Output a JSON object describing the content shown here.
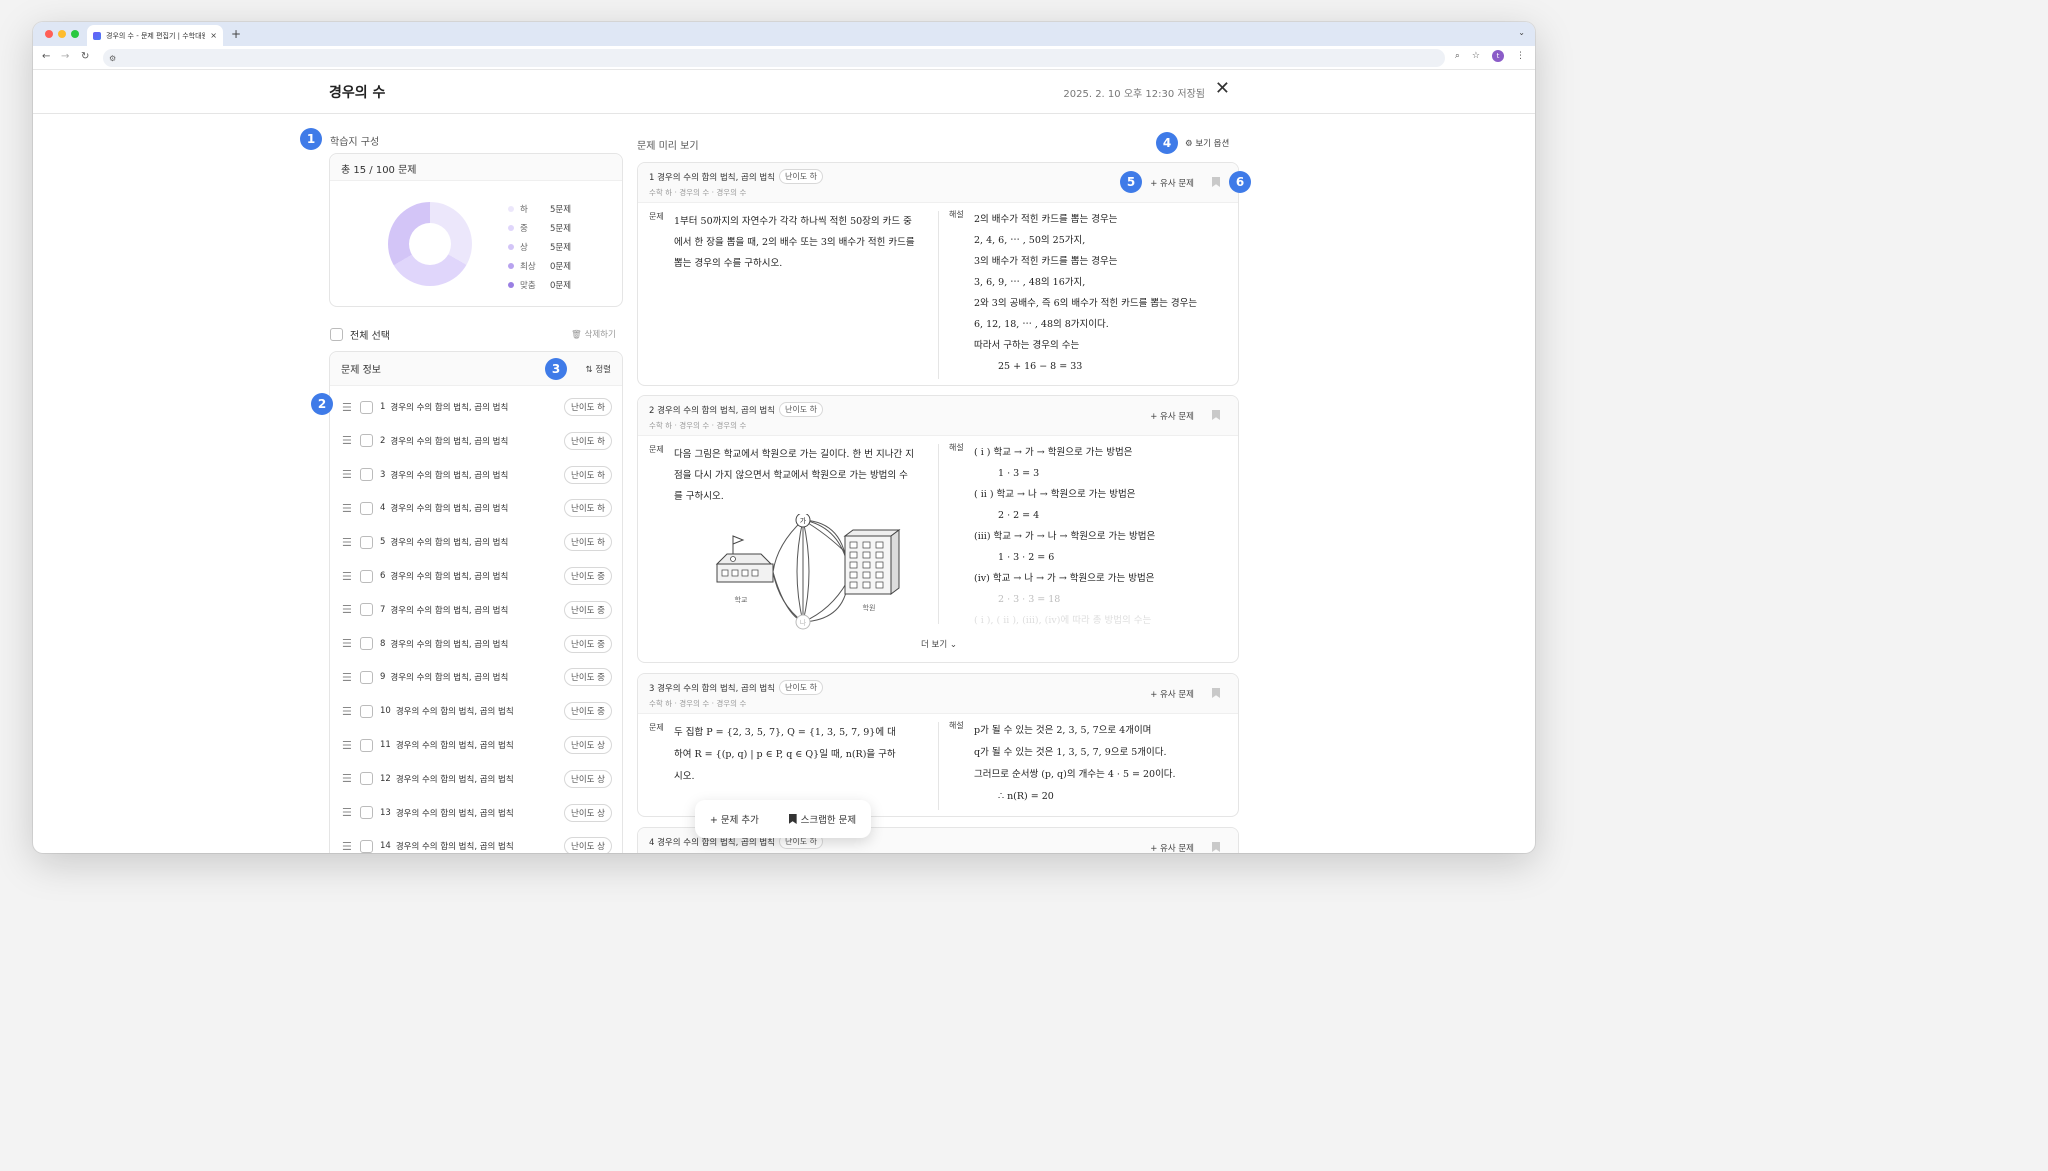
{
  "browser": {
    "tab_title": "경우의 수 - 문제 편집기 | 수학대왕",
    "new_tab": "+",
    "tab_close": "×"
  },
  "header": {
    "title": "경우의 수",
    "save_status": "2025. 2. 10 오후 12:30 저장됨",
    "close": "✕"
  },
  "markers": [
    "1",
    "2",
    "3",
    "4",
    "5",
    "6"
  ],
  "worksheet": {
    "label": "학습지 구성",
    "summary": "총 15 / 100 문제",
    "legend": [
      {
        "label": "하",
        "count": "5문제",
        "color": "#ece7fb"
      },
      {
        "label": "중",
        "count": "5문제",
        "color": "#e0d6fb"
      },
      {
        "label": "상",
        "count": "5문제",
        "color": "#d3c5f7"
      },
      {
        "label": "최상",
        "count": "0문제",
        "color": "#b8a3ef"
      },
      {
        "label": "맞춤",
        "count": "0문제",
        "color": "#9a7fe3"
      }
    ],
    "select_all": "전체 선택",
    "delete": "🗑 삭제하기",
    "list_title": "문제 정보",
    "sort": "⇅ 정렬",
    "problems": [
      {
        "num": "1",
        "title": "경우의 수의 합의 법칙, 곱의 법칙",
        "diff": "난이도 하"
      },
      {
        "num": "2",
        "title": "경우의 수의 합의 법칙, 곱의 법칙",
        "diff": "난이도 하"
      },
      {
        "num": "3",
        "title": "경우의 수의 합의 법칙, 곱의 법칙",
        "diff": "난이도 하"
      },
      {
        "num": "4",
        "title": "경우의 수의 합의 법칙, 곱의 법칙",
        "diff": "난이도 하"
      },
      {
        "num": "5",
        "title": "경우의 수의 합의 법칙, 곱의 법칙",
        "diff": "난이도 하"
      },
      {
        "num": "6",
        "title": "경우의 수의 합의 법칙, 곱의 법칙",
        "diff": "난이도 중"
      },
      {
        "num": "7",
        "title": "경우의 수의 합의 법칙, 곱의 법칙",
        "diff": "난이도 중"
      },
      {
        "num": "8",
        "title": "경우의 수의 합의 법칙, 곱의 법칙",
        "diff": "난이도 중"
      },
      {
        "num": "9",
        "title": "경우의 수의 합의 법칙, 곱의 법칙",
        "diff": "난이도 중"
      },
      {
        "num": "10",
        "title": "경우의 수의 합의 법칙, 곱의 법칙",
        "diff": "난이도 중"
      },
      {
        "num": "11",
        "title": "경우의 수의 합의 법칙, 곱의 법칙",
        "diff": "난이도 상"
      },
      {
        "num": "12",
        "title": "경우의 수의 합의 법칙, 곱의 법칙",
        "diff": "난이도 상"
      },
      {
        "num": "13",
        "title": "경우의 수의 합의 법칙, 곱의 법칙",
        "diff": "난이도 상"
      },
      {
        "num": "14",
        "title": "경우의 수의 합의 법칙, 곱의 법칙",
        "diff": "난이도 상"
      }
    ]
  },
  "preview": {
    "label": "문제 미리 보기",
    "view_options": "⚙ 보기 옵션",
    "similar": "+ 유사 문제",
    "problem_tag": "문제",
    "solution_tag": "해설",
    "more": "더 보기 ⌄",
    "items": [
      {
        "title": "1 경우의 수의 합의 법칙, 곱의 법칙",
        "diff": "난이도 하",
        "path": "수학 하 · 경우의 수 · 경우의 수",
        "problem": [
          "1부터 50까지의 자연수가 각각 하나씩 적힌 50장의 카드 중",
          "에서 한 장을 뽑을 때, 2의 배수 또는 3의 배수가 적힌 카드를",
          "뽑는 경우의 수를 구하시오."
        ],
        "solution": [
          "2의 배수가 적힌 카드를 뽑는 경우는",
          "2, 4, 6, ⋯ , 50의 25가지,",
          "3의 배수가 적힌 카드를 뽑는 경우는",
          "3, 6, 9, ⋯ , 48의 16가지,",
          "2와 3의 공배수, 즉 6의 배수가 적힌 카드를 뽑는 경우는",
          "6, 12, 18, ⋯ , 48의 8가지이다.",
          "따라서 구하는 경우의 수는",
          "25 + 16 − 8 = 33"
        ]
      },
      {
        "title": "2 경우의 수의 합의 법칙, 곱의 법칙",
        "diff": "난이도 하",
        "path": "수학 하 · 경우의 수 · 경우의 수",
        "problem": [
          "다음 그림은 학교에서 학원으로 가는 길이다. 한 번 지나간 지",
          "점을 다시 가지 않으면서 학교에서 학원으로 가는 방법의 수",
          "를 구하시오."
        ],
        "figure": {
          "school": "학교",
          "academy": "학원",
          "node_top": "가",
          "node_bottom": "나"
        },
        "solution": [
          "( i ) 학교 → 가 → 학원으로 가는 방법은",
          "1 · 3 = 3",
          "( ii ) 학교 → 나 → 학원으로 가는 방법은",
          "2 · 2 = 4",
          "(iii) 학교 → 가 → 나 → 학원으로 가는 방법은",
          "1 · 3 · 2 = 6",
          "(iv) 학교 → 나 → 가 → 학원으로 가는 방법은",
          "2 · 3 · 3 = 18",
          "( i ), ( ii ), (iii), (iv)에 따라 총 방법의 수는"
        ]
      },
      {
        "title": "3 경우의 수의 합의 법칙, 곱의 법칙",
        "diff": "난이도 하",
        "path": "수학 하 · 경우의 수 · 경우의 수",
        "problem": [
          "두 집합 P = {2, 3, 5, 7}, Q = {1, 3, 5, 7, 9}에 대",
          "하여 R = {(p, q) | p ∈ P, q ∈ Q}일 때, n(R)을 구하",
          "시오."
        ],
        "solution": [
          "p가 될 수 있는 것은 2, 3, 5, 7으로 4개이며",
          "q가 될 수 있는 것은 1, 3, 5, 7, 9으로 5개이다.",
          "그러므로 순서쌍 (p, q)의 개수는 4 · 5 = 20이다.",
          "∴ n(R) = 20"
        ]
      },
      {
        "title": "4 경우의 수의 합의 법칙, 곱의 법칙",
        "diff": "난이도 하"
      }
    ]
  },
  "fab": {
    "add": "+ 문제 추가",
    "scrap": "스크랩한 문제"
  }
}
